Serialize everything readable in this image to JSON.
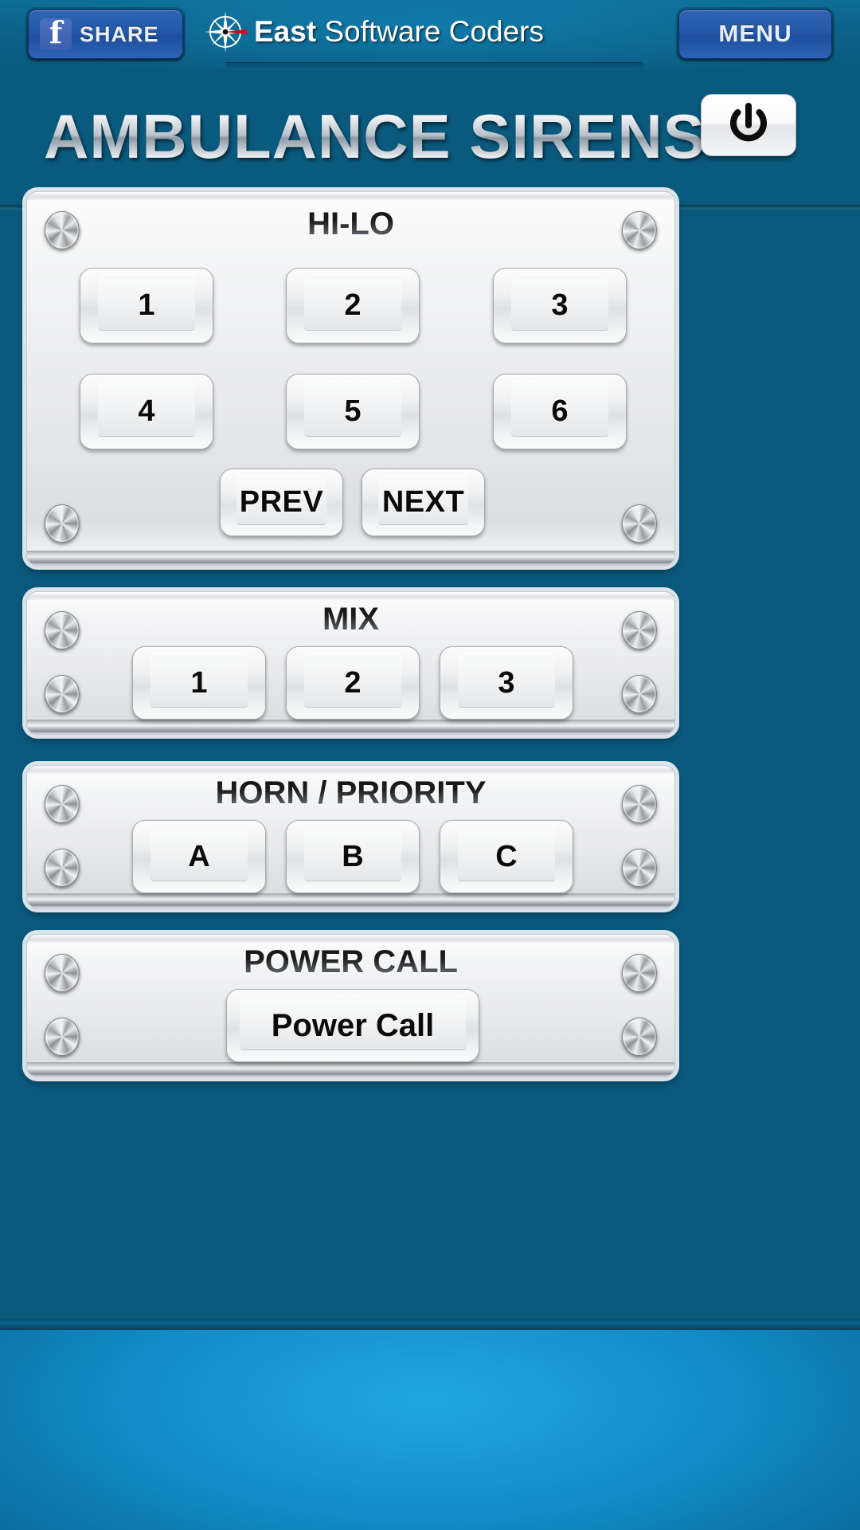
{
  "topbar": {
    "share_button": {
      "label": "SHARE",
      "icon": "facebook-icon"
    },
    "brand": {
      "bold": "East",
      "regular": " Software Coders",
      "icon": "compass-icon"
    },
    "menu_button": {
      "label": "MENU"
    }
  },
  "header": {
    "app_title": "AMBULANCE SIRENS",
    "power_button": {
      "icon": "power-icon"
    }
  },
  "panels": [
    {
      "title": "HI-LO",
      "buttons": [
        "1",
        "2",
        "3",
        "4",
        "5",
        "6"
      ],
      "nav": [
        "PREV",
        "NEXT"
      ]
    },
    {
      "title": "MIX",
      "buttons": [
        "1",
        "2",
        "3"
      ]
    },
    {
      "title": "HORN / PRIORITY",
      "buttons": [
        "A",
        "B",
        "C"
      ]
    },
    {
      "title": "POWER CALL",
      "buttons": [
        "Power Call"
      ]
    }
  ],
  "colors": {
    "background_blue": "#0a587b",
    "accent_blue": "#108cc6",
    "button_blue": "#2458a8",
    "panel_silver": "#e9eaec",
    "title_chrome": "#b9c2ca"
  }
}
